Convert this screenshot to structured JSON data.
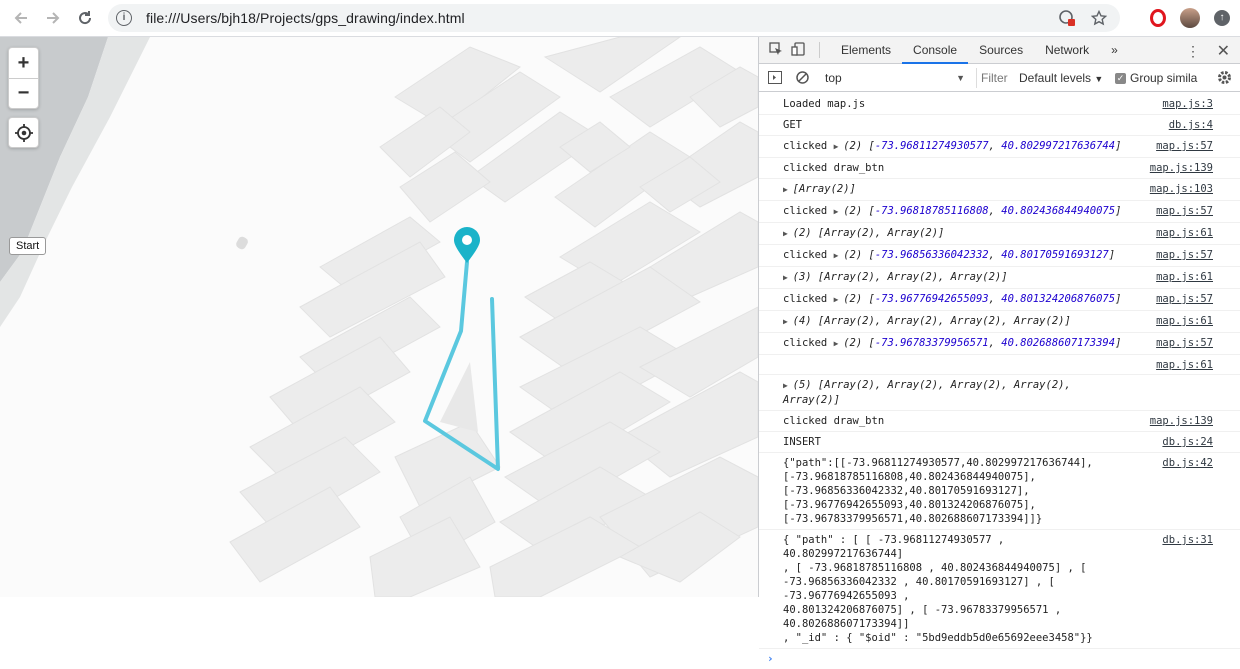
{
  "browser": {
    "url": "file:///Users/bjh18/Projects/gps_drawing/index.html",
    "back_icon": "back-arrow-icon",
    "forward_icon": "forward-arrow-icon",
    "reload_icon": "reload-icon"
  },
  "map": {
    "zoom_in": "+",
    "zoom_out": "−",
    "start_label": "Start",
    "route_color": "#5bc8df",
    "marker_color": "#1ab3c9"
  },
  "devtools": {
    "tabs": [
      "Elements",
      "Console",
      "Sources",
      "Network"
    ],
    "selected_tab": "Console",
    "more_tabs": "»",
    "context": "top",
    "filter_placeholder": "Filter",
    "levels": "Default levels",
    "group_similar": "Group simila"
  },
  "console": [
    {
      "text": "Loaded map.js",
      "src": "map.js:3"
    },
    {
      "text": "GET",
      "src": "db.js:4"
    },
    {
      "prefix": "clicked ",
      "tri": true,
      "label": "(2) ",
      "a": "-73.96811274930577",
      "b": "40.802997217636744",
      "src": "map.js:57"
    },
    {
      "text": "clicked draw_btn",
      "src": "map.js:139"
    },
    {
      "arrtext": "[Array(2)]",
      "src": "map.js:103"
    },
    {
      "prefix": "clicked ",
      "tri": true,
      "label": "(2) ",
      "a": "-73.96818785116808",
      "b": "40.802436844940075",
      "src": "map.js:57"
    },
    {
      "arrtext": "(2) [Array(2), Array(2)]",
      "src": "map.js:61"
    },
    {
      "prefix": "clicked ",
      "tri": true,
      "label": "(2) ",
      "a": "-73.96856336042332",
      "b": "40.80170591693127",
      "src": "map.js:57"
    },
    {
      "arrtext": "(3) [Array(2), Array(2), Array(2)]",
      "src": "map.js:61"
    },
    {
      "prefix": "clicked ",
      "tri": true,
      "label": "(2) ",
      "a": "-73.96776942655093",
      "b": "40.801324206876075",
      "src": "map.js:57"
    },
    {
      "arrtext": "(4) [Array(2), Array(2), Array(2), Array(2)]",
      "src": "map.js:61"
    },
    {
      "prefix": "clicked ",
      "tri": true,
      "label": "(2) ",
      "a": "-73.96783379956571",
      "b": "40.802688607173394",
      "src": "map.js:57"
    },
    {
      "text": "",
      "src": "map.js:61"
    },
    {
      "arrtext": "(5) [Array(2), Array(2), Array(2), Array(2), Array(2)]",
      "src": ""
    },
    {
      "text": "clicked draw_btn",
      "src": "map.js:139"
    },
    {
      "text": "INSERT",
      "src": "db.js:24"
    },
    {
      "text": "{\"path\":[[-73.96811274930577,40.802997217636744],\n[-73.96818785116808,40.802436844940075],\n[-73.96856336042332,40.80170591693127],\n[-73.96776942655093,40.801324206876075],\n[-73.96783379956571,40.802688607173394]]}",
      "src": "db.js:42"
    },
    {
      "text": "{ \"path\" : [ [ -73.96811274930577 , 40.802997217636744]\n, [ -73.96818785116808 , 40.802436844940075] , [\n-73.96856336042332 , 40.80170591693127] , [ -73.96776942655093 ,\n40.801324206876075] , [ -73.96783379956571 , 40.802688607173394]]\n, \"_id\" : { \"$oid\" : \"5bd9eddb5d0e65692eee3458\"}}",
      "src": "db.js:31"
    }
  ],
  "prompt": "›"
}
